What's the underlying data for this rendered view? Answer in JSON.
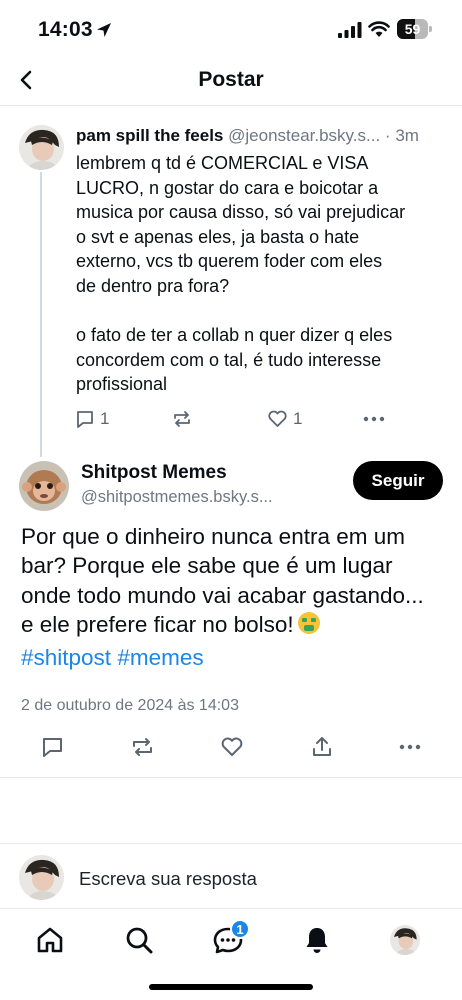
{
  "status_bar": {
    "time": "14:03",
    "battery_level": "59",
    "icons": [
      "location-arrow-icon",
      "signal-icon",
      "wifi-icon",
      "battery-icon"
    ]
  },
  "header": {
    "title": "Postar",
    "back_icon": "chevron-left-icon"
  },
  "parent_post": {
    "author_name": "pam spill the feels",
    "author_handle": "@jeonstear.bsky.s...",
    "separator": "·",
    "time_ago": "3m",
    "text": "lembrem q td é COMERCIAL e VISA\nLUCRO, n gostar do cara e boicotar a\nmusica por causa disso, só vai prejudicar\no svt e apenas eles, ja basta o hate\nexterno, vcs tb querem foder com eles\nde dentro pra fora?\n\no fato de ter a collab n quer dizer q eles\nconcordem com o tal, é tudo interesse\nprofissional",
    "reply_count": "1",
    "like_count": "1"
  },
  "main_post": {
    "author_name": "Shitpost Memes",
    "author_handle": "@shitpostmemes.bsky.s...",
    "follow_label": "Seguir",
    "text": "Por que o dinheiro nunca entra em um\nbar? Porque ele sabe que é um lugar\nonde todo mundo vai acabar gastando...\ne ele prefere ficar no bolso!",
    "hashtag_1": "#shitpost",
    "hashtag_2": "#memes",
    "date": "2 de outubro de 2024 às 14:03"
  },
  "reply_composer": {
    "placeholder": "Escreva sua resposta"
  },
  "bottom_nav": {
    "items": [
      "home-icon",
      "search-icon",
      "chat-icon",
      "bell-icon",
      "profile-avatar"
    ],
    "chat_badge": "1"
  },
  "colors": {
    "accent": "#1a86e8",
    "muted_text": "#6f7782",
    "divider": "#e6e9ec"
  }
}
